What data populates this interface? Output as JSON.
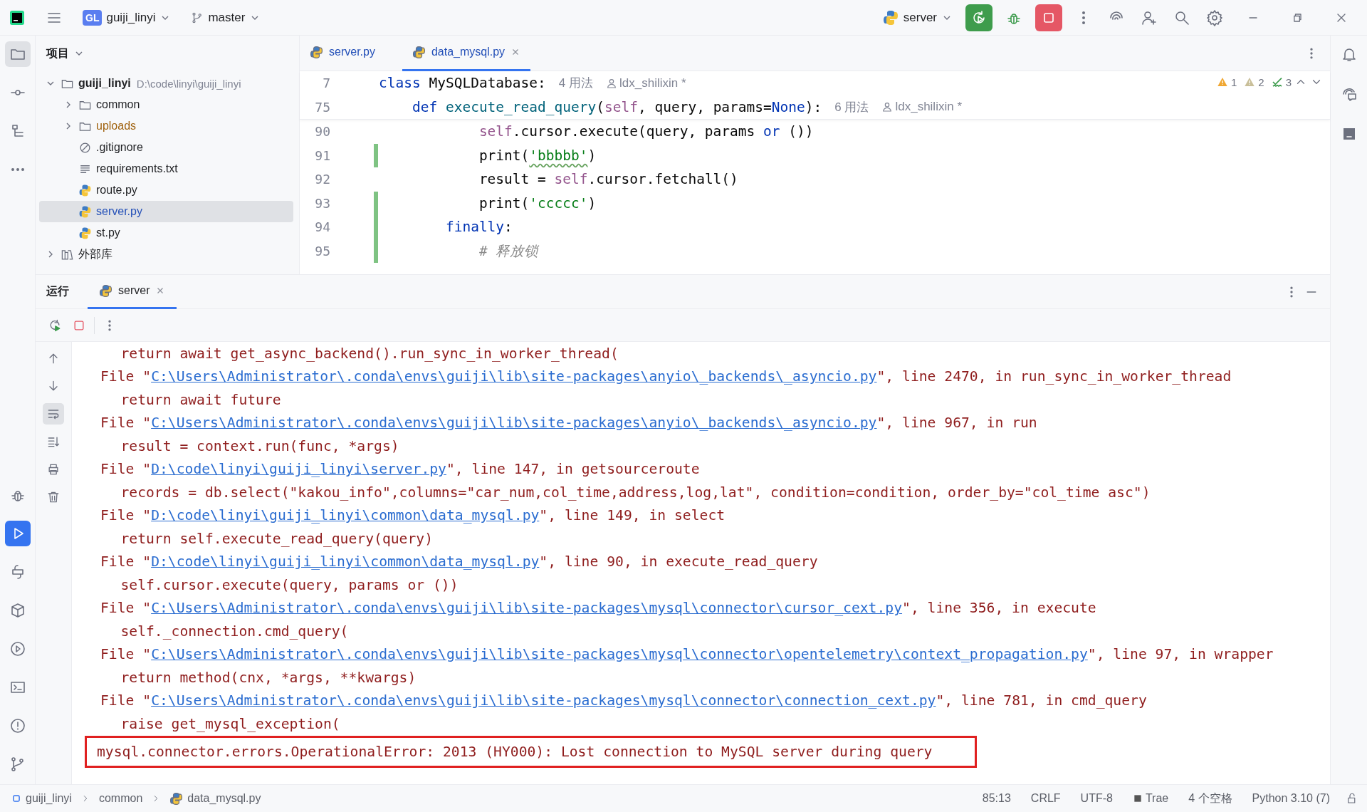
{
  "title_bar": {
    "project_badge": "GL",
    "project": "guiji_linyi",
    "branch": "master",
    "run_config": "server"
  },
  "left_toolbar": {
    "top": [
      {
        "kind": "project",
        "selected": true
      },
      {
        "kind": "commit",
        "selected": false
      },
      {
        "kind": "structure",
        "selected": false
      },
      {
        "kind": "more",
        "selected": false
      }
    ],
    "bottom": [
      {
        "kind": "debug",
        "selected": false
      },
      {
        "kind": "run",
        "selected": true
      },
      {
        "kind": "python-console",
        "selected": false
      },
      {
        "kind": "packages",
        "selected": false
      },
      {
        "kind": "services",
        "selected": false
      },
      {
        "kind": "terminal",
        "selected": false
      },
      {
        "kind": "problems",
        "selected": false
      },
      {
        "kind": "git",
        "selected": false
      }
    ]
  },
  "project": {
    "title": "项目",
    "tree": [
      {
        "label": "guiji_linyi",
        "kind": "folder",
        "path": "D:\\code\\linyi\\guiji_linyi",
        "expanded": true,
        "selected": false,
        "children": [
          {
            "label": "common",
            "kind": "folder",
            "expanded": false,
            "excluded": false,
            "selected": false
          },
          {
            "label": "uploads",
            "kind": "folder",
            "expanded": false,
            "excluded": true,
            "selected": false
          },
          {
            "label": ".gitignore",
            "kind": "ignore",
            "selected": false
          },
          {
            "label": "requirements.txt",
            "kind": "text",
            "selected": false
          },
          {
            "label": "route.py",
            "kind": "python",
            "selected": false
          },
          {
            "label": "server.py",
            "kind": "python",
            "selected": true
          },
          {
            "label": "st.py",
            "kind": "python",
            "selected": false
          }
        ]
      },
      {
        "label": "外部库",
        "kind": "library",
        "expanded": false,
        "selected": false
      }
    ]
  },
  "editor": {
    "tabs": [
      {
        "label": "server.py",
        "selected": false
      },
      {
        "label": "data_mysql.py",
        "selected": true
      }
    ],
    "inspections": {
      "warnings": "1",
      "weak_warnings": "2",
      "typos": "3"
    },
    "sticky_lines": [
      {
        "number": "7",
        "usages": "4 用法",
        "author": "ldx_shilixin *",
        "tokens": [
          {
            "text": "class ",
            "kind": "keyword"
          },
          {
            "text": "MySQLDatabase:",
            "kind": "plain"
          }
        ]
      },
      {
        "number": "75",
        "usages": "6 用法",
        "author": "ldx_shilixin *",
        "tokens": [
          {
            "text": "    def ",
            "kind": "keyword"
          },
          {
            "text": "execute_read_query",
            "kind": "fn"
          },
          {
            "text": "(",
            "kind": "plain"
          },
          {
            "text": "self",
            "kind": "self"
          },
          {
            "text": ", query, params=",
            "kind": "plain"
          },
          {
            "text": "None",
            "kind": "keyword"
          },
          {
            "text": "):",
            "kind": "plain"
          }
        ]
      }
    ],
    "lines": [
      {
        "number": "90",
        "changed": false,
        "tokens": [
          {
            "text": "            self",
            "kind": "self"
          },
          {
            "text": ".cursor.execute(query, params ",
            "kind": "plain"
          },
          {
            "text": "or",
            "kind": "keyword"
          },
          {
            "text": " ())",
            "kind": "plain"
          }
        ]
      },
      {
        "number": "91",
        "changed": true,
        "tokens": [
          {
            "text": "            print(",
            "kind": "plain"
          },
          {
            "text": "'bbbbb'",
            "kind": "typo_string"
          },
          {
            "text": ")",
            "kind": "plain"
          }
        ]
      },
      {
        "number": "92",
        "changed": false,
        "tokens": [
          {
            "text": "            result = ",
            "kind": "plain"
          },
          {
            "text": "self",
            "kind": "self"
          },
          {
            "text": ".cursor.fetchall()",
            "kind": "plain"
          }
        ]
      },
      {
        "number": "93",
        "changed": true,
        "tokens": [
          {
            "text": "            print(",
            "kind": "plain"
          },
          {
            "text": "'ccccc'",
            "kind": "string"
          },
          {
            "text": ")",
            "kind": "plain"
          }
        ]
      },
      {
        "number": "94",
        "changed": true,
        "tokens": [
          {
            "text": "        finally",
            "kind": "keyword"
          },
          {
            "text": ":",
            "kind": "plain"
          }
        ]
      },
      {
        "number": "95",
        "changed": true,
        "tokens": [
          {
            "text": "            # 释放锁",
            "kind": "comment"
          }
        ]
      }
    ]
  },
  "run": {
    "title": "运行",
    "tabs": [
      {
        "label": "server",
        "selected": true
      }
    ],
    "side_tools": [
      {
        "kind": "up",
        "selected": false
      },
      {
        "kind": "down",
        "selected": false
      },
      {
        "kind": "wrap",
        "selected": true
      },
      {
        "kind": "scroll-end",
        "selected": false
      },
      {
        "kind": "print",
        "selected": false
      },
      {
        "kind": "trash",
        "selected": false
      }
    ],
    "lines": [
      {
        "kind": "code",
        "text": "return await get_async_backend().run_sync_in_worker_thread("
      },
      {
        "kind": "file",
        "prefix": "File \"",
        "path": "C:\\Users\\Administrator\\.conda\\envs\\guiji\\lib\\site-packages\\anyio\\_backends\\_asyncio.py",
        "suffix": "\", line 2470, in run_sync_in_worker_thread"
      },
      {
        "kind": "code",
        "text": "return await future"
      },
      {
        "kind": "file",
        "prefix": "File \"",
        "path": "C:\\Users\\Administrator\\.conda\\envs\\guiji\\lib\\site-packages\\anyio\\_backends\\_asyncio.py",
        "suffix": "\", line 967, in run"
      },
      {
        "kind": "code",
        "text": "result = context.run(func, *args)"
      },
      {
        "kind": "file",
        "prefix": "File \"",
        "path": "D:\\code\\linyi\\guiji_linyi\\server.py",
        "suffix": "\", line 147, in getsourceroute"
      },
      {
        "kind": "code",
        "text": "records = db.select(\"kakou_info\",columns=\"car_num,col_time,address,log,lat\", condition=condition, order_by=\"col_time asc\")"
      },
      {
        "kind": "file",
        "prefix": "File \"",
        "path": "D:\\code\\linyi\\guiji_linyi\\common\\data_mysql.py",
        "suffix": "\", line 149, in select"
      },
      {
        "kind": "code",
        "text": "return self.execute_read_query(query)"
      },
      {
        "kind": "file",
        "prefix": "File \"",
        "path": "D:\\code\\linyi\\guiji_linyi\\common\\data_mysql.py",
        "suffix": "\", line 90, in execute_read_query"
      },
      {
        "kind": "code",
        "text": "self.cursor.execute(query, params or ())"
      },
      {
        "kind": "file",
        "prefix": "File \"",
        "path": "C:\\Users\\Administrator\\.conda\\envs\\guiji\\lib\\site-packages\\mysql\\connector\\cursor_cext.py",
        "suffix": "\", line 356, in execute"
      },
      {
        "kind": "code",
        "text": "self._connection.cmd_query("
      },
      {
        "kind": "file",
        "prefix": "File \"",
        "path": "C:\\Users\\Administrator\\.conda\\envs\\guiji\\lib\\site-packages\\mysql\\connector\\opentelemetry\\context_propagation.py",
        "suffix": "\", line 97, in wrapper"
      },
      {
        "kind": "code",
        "text": "return method(cnx, *args, **kwargs)"
      },
      {
        "kind": "file",
        "prefix": "File \"",
        "path": "C:\\Users\\Administrator\\.conda\\envs\\guiji\\lib\\site-packages\\mysql\\connector\\connection_cext.py",
        "suffix": "\", line 781, in cmd_query"
      },
      {
        "kind": "code",
        "text": "raise get_mysql_exception("
      },
      {
        "kind": "error",
        "highlighted": true,
        "text": "mysql.connector.errors.OperationalError: 2013 (HY000): Lost connection to MySQL server during query"
      }
    ]
  },
  "status_bar": {
    "breadcrumbs": [
      "guiji_linyi",
      "common",
      "data_mysql.py"
    ],
    "position": "85:13",
    "line_ending": "CRLF",
    "encoding": "UTF-8",
    "plugin": "Trae",
    "indent": "4 个空格",
    "interpreter": "Python 3.10 (7)"
  }
}
